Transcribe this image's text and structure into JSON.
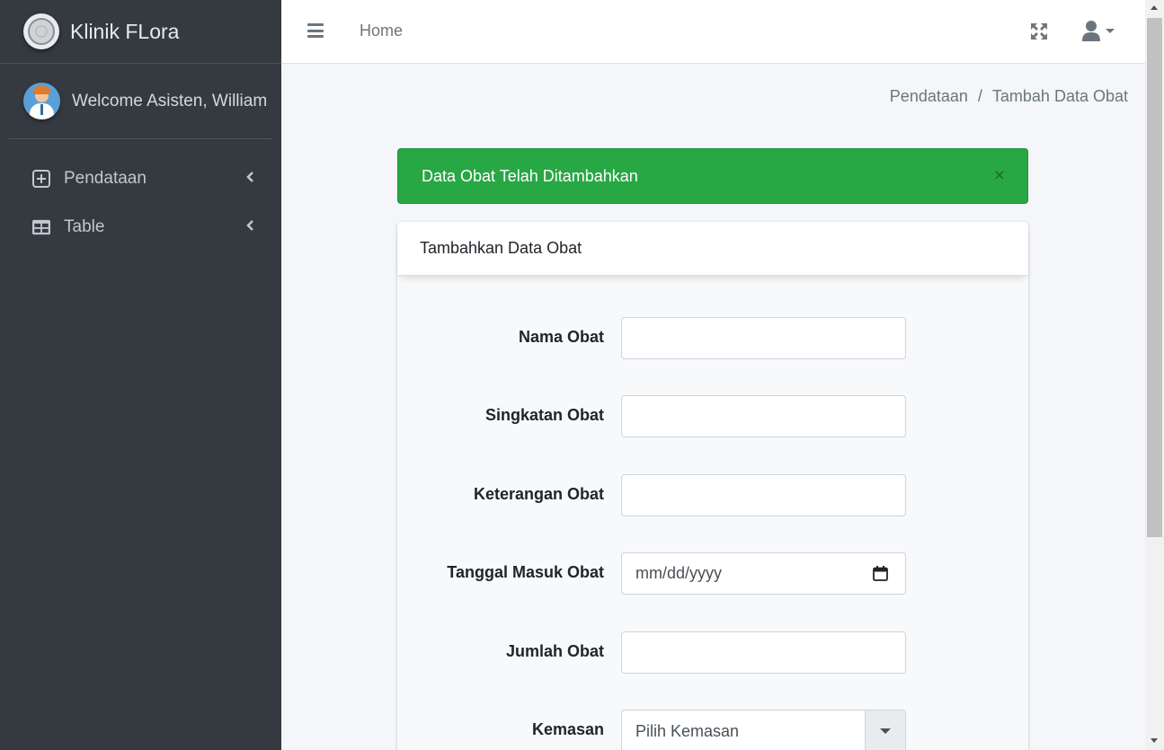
{
  "brand": {
    "name": "Klinik FLora",
    "logo_icon": "clinic-logo"
  },
  "user_panel": {
    "welcome_text": "Welcome Asisten, William",
    "avatar_icon": "user-avatar"
  },
  "sidebar": {
    "items": [
      {
        "label": "Pendataan",
        "icon": "plus-square-icon"
      },
      {
        "label": "Table",
        "icon": "table-icon"
      }
    ]
  },
  "topbar": {
    "home_label": "Home"
  },
  "breadcrumb": {
    "items": [
      "Pendataan",
      "Tambah Data Obat"
    ],
    "separator": "/"
  },
  "alert": {
    "message": "Data Obat Telah Ditambahkan",
    "close": "×",
    "color": "#28a745"
  },
  "card": {
    "title": "Tambahkan Data Obat",
    "fields": [
      {
        "label": "Nama Obat",
        "value": ""
      },
      {
        "label": "Singkatan Obat",
        "value": ""
      },
      {
        "label": "Keterangan Obat",
        "value": ""
      },
      {
        "label": "Tanggal Masuk Obat",
        "placeholder": "mm/dd/yyyy"
      },
      {
        "label": "Jumlah Obat",
        "value": ""
      },
      {
        "label": "Kemasan",
        "selected": "Pilih Kemasan"
      }
    ]
  }
}
